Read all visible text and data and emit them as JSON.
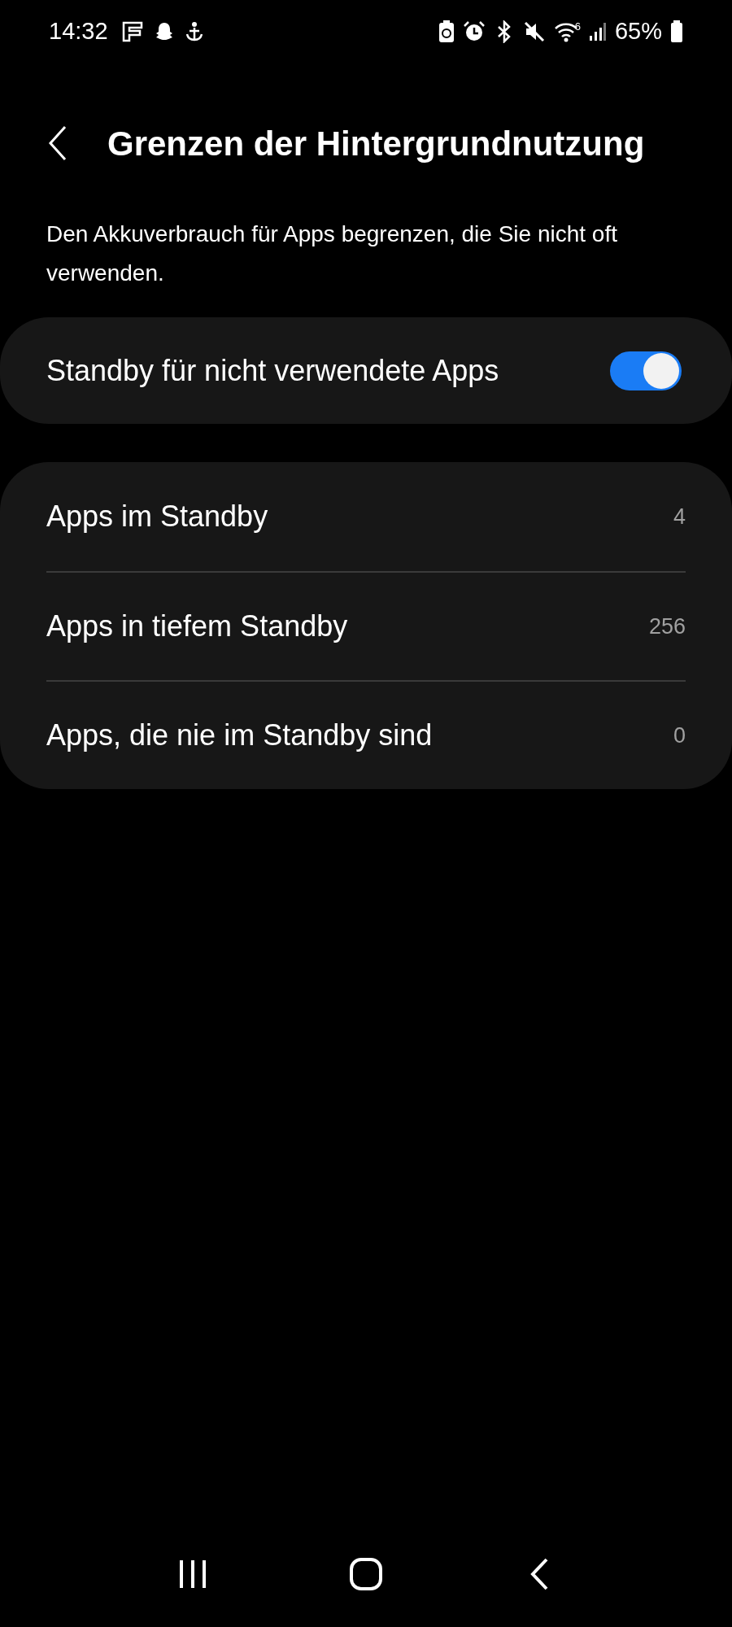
{
  "status_bar": {
    "time": "14:32",
    "wifi_label": "6",
    "battery": "65%"
  },
  "header": {
    "title": "Grenzen der Hintergrundnutzung"
  },
  "description": "Den Akkuverbrauch für Apps begrenzen, die Sie nicht oft verwenden.",
  "toggle_row": {
    "label": "Standby für nicht verwendete Apps",
    "on": true
  },
  "list": [
    {
      "label": "Apps im Standby",
      "count": "4"
    },
    {
      "label": "Apps in tiefem Standby",
      "count": "256"
    },
    {
      "label": "Apps, die nie im Standby sind",
      "count": "0"
    }
  ]
}
